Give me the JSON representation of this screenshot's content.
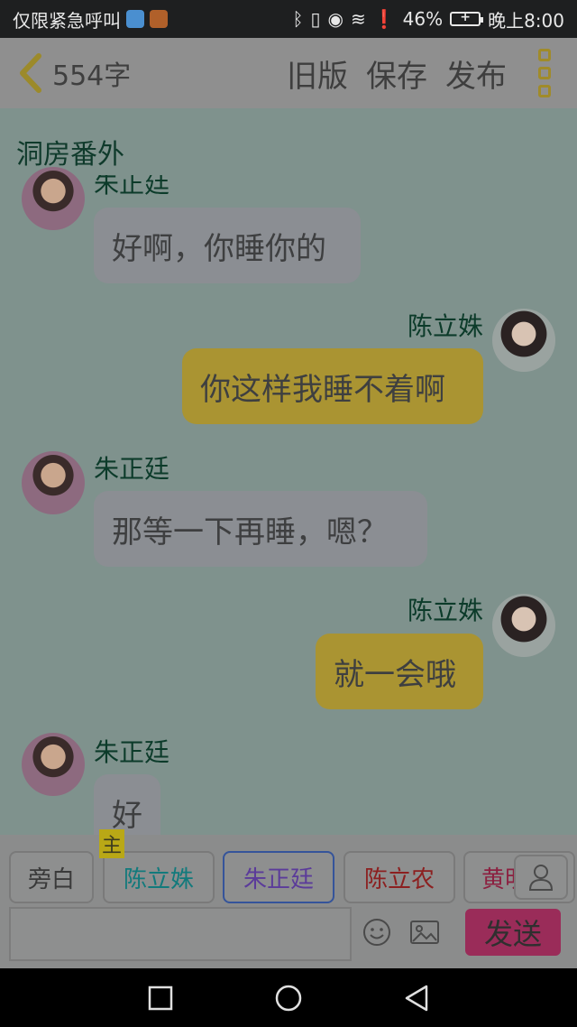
{
  "status_bar": {
    "carrier": "仅限紧急呼叫",
    "battery_percent": "46%",
    "time": "晚上8:00",
    "icons": [
      "app-icon-1",
      "app-icon-2",
      "bluetooth-icon",
      "vibrate-icon",
      "eye-icon",
      "wifi-icon",
      "alert-icon",
      "battery-icon"
    ]
  },
  "header": {
    "word_count": "554字",
    "buttons": [
      "旧版",
      "保存",
      "发布"
    ]
  },
  "chat": {
    "title": "洞房番外",
    "messages": [
      {
        "speaker": "朱正廷",
        "side": "left",
        "text": "好啊，你睡你的"
      },
      {
        "speaker": "陈立姝",
        "side": "right",
        "text": "你这样我睡不着啊"
      },
      {
        "speaker": "朱正廷",
        "side": "left",
        "text": "那等一下再睡，嗯？"
      },
      {
        "speaker": "陈立姝",
        "side": "right",
        "text": "就一会哦"
      },
      {
        "speaker": "朱正廷",
        "side": "left",
        "text": "好"
      }
    ]
  },
  "composer": {
    "roles": [
      {
        "label": "旁白",
        "color": "#3a3a3a"
      },
      {
        "label": "陈立姝",
        "color": "#127a7c"
      },
      {
        "label": "朱正廷",
        "color": "#5b3b9a"
      },
      {
        "label": "陈立农",
        "color": "#8c2020"
      },
      {
        "label": "黄明",
        "color": "#8c2040"
      }
    ],
    "main_tag": "主",
    "send_label": "发送",
    "input_placeholder": ""
  },
  "colors": {
    "accent_send": "#9a2c59",
    "bubble_right": "#aa9432",
    "bubble_left": "#8b8e93",
    "chat_bg": "#7f928d"
  }
}
